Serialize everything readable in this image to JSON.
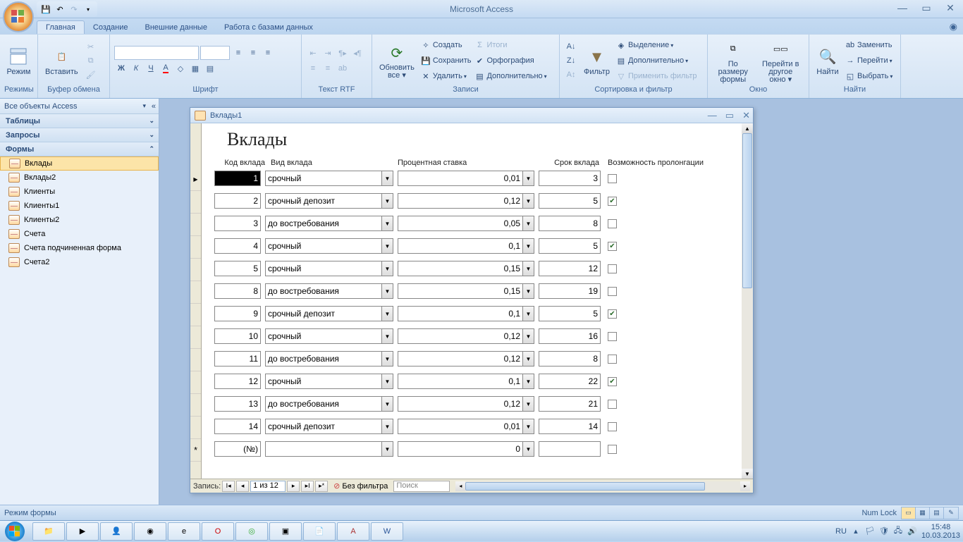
{
  "app": {
    "title": "Microsoft Access"
  },
  "ribbon": {
    "tabs": [
      "Главная",
      "Создание",
      "Внешние данные",
      "Работа с базами данных"
    ],
    "groups": {
      "view": {
        "label": "Режимы",
        "btn": "Режим"
      },
      "clipboard": {
        "label": "Буфер обмена",
        "paste": "Вставить"
      },
      "font": {
        "label": "Шрифт"
      },
      "richtext": {
        "label": "Текст RTF"
      },
      "records": {
        "label": "Записи",
        "refresh": "Обновить\nвсе",
        "new": "Создать",
        "save": "Сохранить",
        "delete": "Удалить",
        "totals": "Итоги",
        "spelling": "Орфография",
        "more": "Дополнительно"
      },
      "sortfilter": {
        "label": "Сортировка и фильтр",
        "filter": "Фильтр",
        "selection": "Выделение",
        "advanced": "Дополнительно",
        "toggle": "Применить фильтр"
      },
      "window": {
        "label": "Окно",
        "size": "По размеру\nформы",
        "switch": "Перейти в\nдругое окно"
      },
      "find": {
        "label": "Найти",
        "find": "Найти",
        "replace": "Заменить",
        "goto": "Перейти",
        "select": "Выбрать"
      }
    }
  },
  "nav": {
    "header": "Все объекты Access",
    "tables": "Таблицы",
    "queries": "Запросы",
    "forms": "Формы",
    "items": [
      "Вклады",
      "Вклады2",
      "Клиенты",
      "Клиенты1",
      "Клиенты2",
      "Счета",
      "Счета подчиненная форма",
      "Счета2"
    ]
  },
  "form": {
    "title": "Вклады1",
    "heading": "Вклады",
    "columns": {
      "code": "Код вклада",
      "type": "Вид вклада",
      "rate": "Процентная ставка",
      "term": "Срок вклада",
      "prolong": "Возможность пролонгации"
    },
    "records": [
      {
        "code": "1",
        "type": "срочный",
        "rate": "0,01",
        "term": "3",
        "prolong": false,
        "current": true
      },
      {
        "code": "2",
        "type": "срочный депозит",
        "rate": "0,12",
        "term": "5",
        "prolong": true
      },
      {
        "code": "3",
        "type": "до востребования",
        "rate": "0,05",
        "term": "8",
        "prolong": false
      },
      {
        "code": "4",
        "type": "срочный",
        "rate": "0,1",
        "term": "5",
        "prolong": true
      },
      {
        "code": "5",
        "type": "срочный",
        "rate": "0,15",
        "term": "12",
        "prolong": false
      },
      {
        "code": "8",
        "type": "до востребования",
        "rate": "0,15",
        "term": "19",
        "prolong": false
      },
      {
        "code": "9",
        "type": "срочный депозит",
        "rate": "0,1",
        "term": "5",
        "prolong": true
      },
      {
        "code": "10",
        "type": "срочный",
        "rate": "0,12",
        "term": "16",
        "prolong": false
      },
      {
        "code": "11",
        "type": "до востребования",
        "rate": "0,12",
        "term": "8",
        "prolong": false
      },
      {
        "code": "12",
        "type": "срочный",
        "rate": "0,1",
        "term": "22",
        "prolong": true
      },
      {
        "code": "13",
        "type": "до востребования",
        "rate": "0,12",
        "term": "21",
        "prolong": false
      },
      {
        "code": "14",
        "type": "срочный депозит",
        "rate": "0,01",
        "term": "14",
        "prolong": false
      }
    ],
    "newrow": {
      "code": "(№)",
      "rate": "0"
    },
    "nav": {
      "label": "Запись:",
      "pos": "1 из 12",
      "nofilter": "Без фильтра",
      "search": "Поиск"
    }
  },
  "status": {
    "mode": "Режим формы",
    "numlock": "Num Lock"
  },
  "taskbar": {
    "lang": "RU",
    "time": "15:48",
    "date": "10.03.2013"
  }
}
